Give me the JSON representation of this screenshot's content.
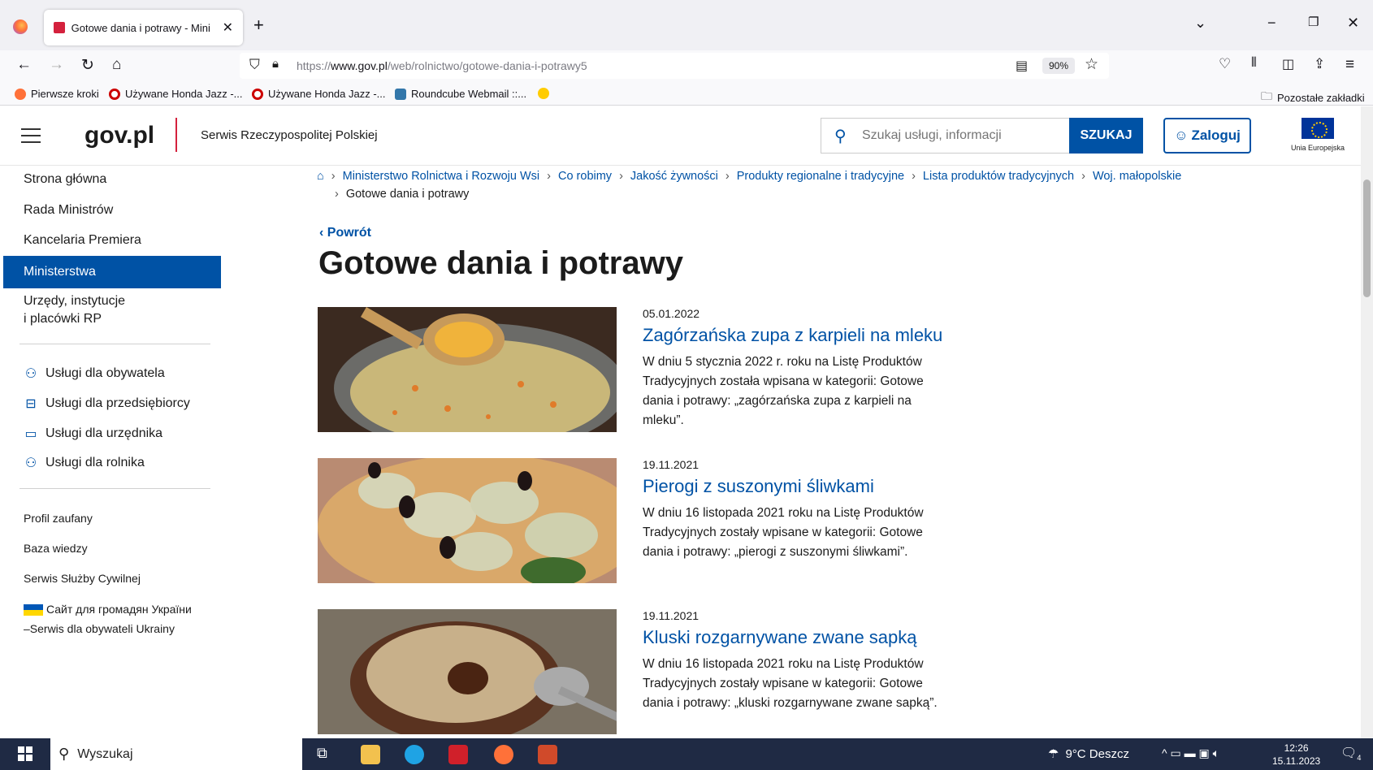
{
  "browser": {
    "tab_title": "Gotowe dania i potrawy - Mini",
    "url_prefix": "https://",
    "url_domain": "www.gov.pl",
    "url_path": "/web/rolnictwo/gotowe-dania-i-potrawy5",
    "zoom": "90%",
    "bookmarks": [
      "Pierwsze kroki",
      "Używane Honda Jazz -...",
      "Używane Honda Jazz -...",
      "Roundcube Webmail ::..."
    ],
    "other_bookmarks": "Pozostałe zakładki"
  },
  "header": {
    "logo": "gov.pl",
    "subtitle": "Serwis Rzeczypospolitej Polskiej",
    "search_placeholder": "Szukaj usługi, informacji",
    "search_button": "SZUKAJ",
    "login_button": "Zaloguj",
    "eu_label": "Unia Europejska"
  },
  "sidebar": {
    "items": [
      "Strona główna",
      "Rada Ministrów",
      "Kancelaria Premiera",
      "Ministerstwa",
      "Urzędy, instytucje",
      "i placówki RP"
    ],
    "services": [
      "Usługi dla obywatela",
      "Usługi dla przedsiębiorcy",
      "Usługi dla urzędnika",
      "Usługi dla rolnika"
    ],
    "links": [
      "Profil zaufany",
      "Baza wiedzy",
      "Serwis Służby Cywilnej",
      "Сайт для громадян України",
      "–Serwis dla obywateli Ukrainy"
    ]
  },
  "breadcrumbs": [
    "Ministerstwo Rolnictwa i Rozwoju Wsi",
    "Co robimy",
    "Jakość żywności",
    "Produkty regionalne i tradycyjne",
    "Lista produktów tradycyjnych",
    "Woj. małopolskie",
    "Gotowe dania i potrawy"
  ],
  "back_label": "Powrót",
  "page_title": "Gotowe dania i potrawy",
  "articles": [
    {
      "date": "05.01.2022",
      "title": "Zagórzańska zupa z karpieli na mleku",
      "desc": "W dniu 5 stycznia 2022 r. roku na Listę Produktów Tradycyjnych została wpisana w kategorii: Gotowe dania i potrawy: „zagórzańska zupa z karpieli na mleku”."
    },
    {
      "date": "19.11.2021",
      "title": "Pierogi z suszonymi śliwkami",
      "desc": "W dniu 16 listopada 2021 roku na Listę Produktów Tradycyjnych zostały wpisane w kategorii: Gotowe dania i potrawy: „pierogi z suszonymi śliwkami”."
    },
    {
      "date": "19.11.2021",
      "title": "Kluski rozgarnywane zwane sapką",
      "desc": "W dniu 16 listopada 2021 roku na Listę Produktów Tradycyjnych zostały wpisane w kategorii: Gotowe dania i potrawy: „kluski rozgarnywane zwane sapką”."
    }
  ],
  "taskbar": {
    "search": "Wyszukaj",
    "weather": "9°C Deszcz",
    "time": "12:26",
    "date": "15.11.2023",
    "notifications": "4"
  }
}
